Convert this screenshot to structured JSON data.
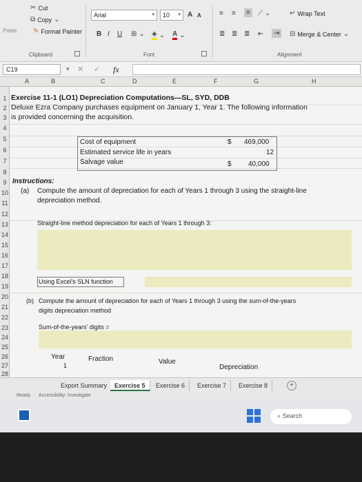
{
  "ribbon": {
    "clipboard": {
      "cut": "Cut",
      "copy": "Copy",
      "paste": "Paste",
      "format_painter": "Format Painter",
      "label": "Clipboard"
    },
    "font": {
      "name": "Arial",
      "size": "10",
      "bold": "B",
      "italic": "I",
      "underline": "U",
      "grow": "A",
      "shrink": "A",
      "label": "Font"
    },
    "alignment": {
      "wrap_text": "Wrap Text",
      "merge_center": "Merge & Center",
      "label": "Alignment"
    }
  },
  "formula_bar": {
    "name_box": "C19",
    "fx": "fx"
  },
  "columns": [
    "A",
    "B",
    "C",
    "D",
    "E",
    "F",
    "G",
    "H"
  ],
  "rows": [
    "1",
    "2",
    "3",
    "4",
    "5",
    "6",
    "7",
    "8",
    "9",
    "10",
    "11",
    "12",
    "13",
    "14",
    "15",
    "16",
    "17",
    "18",
    "19",
    "20",
    "21",
    "22",
    "23",
    "24",
    "25",
    "26",
    "27",
    "28"
  ],
  "sheet": {
    "title": "Exercise 11-1 (LO1) Depreciation Computations—SL, SYD, DDB",
    "intro_line1": "Deluxe Ezra Company purchases equipment on January 1, Year 1. The following information",
    "intro_line2": "is provided concerning the acquisition.",
    "table": [
      {
        "label": "Cost of equipment",
        "currency": "$",
        "value": "469,000"
      },
      {
        "label": "Estimated service life in years",
        "currency": "",
        "value": "12"
      },
      {
        "label": "Salvage value",
        "currency": "$",
        "value": "40,000"
      }
    ],
    "instructions_heading": "Instructions:",
    "part_a_marker": "(a)",
    "part_a_line1": "Compute the amount of depreciation for each of Years 1 through 3 using the straight-line",
    "part_a_line2": "depreciation method.",
    "sl_label": "Straight-line method depreciation for each of Years 1 through 3:",
    "sln_label": "Using Excel's SLN function",
    "part_b_marker": "(b)",
    "part_b_line1": "Compute the amount of depreciation for each of Years 1 through 3 using the sum-of-the-years",
    "part_b_line2": "digits depreciation method",
    "syd_label": "Sum-of-the-years' digits =",
    "headers": {
      "year": "Year",
      "fraction": "Fraction",
      "value": "Value",
      "depreciation": "Depreciation"
    },
    "row28_a": "1"
  },
  "tabs": [
    "Export Summary",
    "Exercise 5",
    "Exercise 6",
    "Exercise 7",
    "Exercise 8"
  ],
  "active_tab": "Exercise 5",
  "status": {
    "ready": "Ready",
    "accessibility": "Accessibility: Investigate"
  },
  "taskbar": {
    "search": "Search"
  }
}
